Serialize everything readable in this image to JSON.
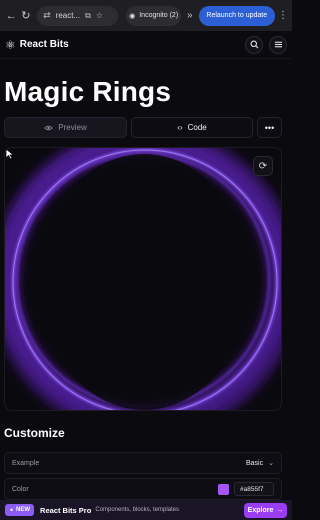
{
  "browser": {
    "address_text": "react...",
    "incognito_label": "Incognito (2)",
    "relaunch_label": "Relaunch to update"
  },
  "header": {
    "brand": "React Bits"
  },
  "page": {
    "title": "Magic Rings",
    "tabs": {
      "preview": "Preview",
      "code": "Code",
      "more": "•••"
    }
  },
  "customize": {
    "heading": "Customize",
    "example_label": "Example",
    "example_value": "Basic",
    "color_label": "Color",
    "color_value": "#a855f7"
  },
  "promo": {
    "badge": "NEW",
    "name": "React Bits Pro",
    "desc": "Components, blocks, templates",
    "cta": "Explore"
  },
  "colors": {
    "ring": "#7c3aed",
    "ring_glow": "#a855f7",
    "accent_button": "#9b3df5",
    "relaunch": "#2d5fd4"
  }
}
